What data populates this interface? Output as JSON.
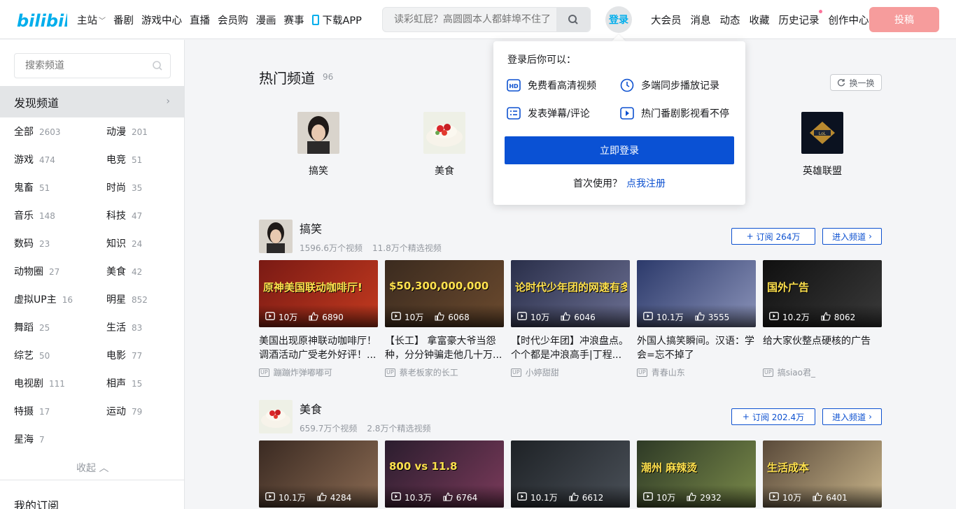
{
  "header": {
    "logo_text": "bilibili",
    "nav_left": [
      "主站",
      "番剧",
      "游戏中心",
      "直播",
      "会员购",
      "漫画",
      "赛事",
      "下载APP"
    ],
    "search_placeholder": "读彩虹屁？高圆圆本人都蚌埠不住了",
    "login_label": "登录",
    "nav_right": [
      "大会员",
      "消息",
      "动态",
      "收藏",
      "历史记录",
      "创作中心"
    ],
    "upload_label": "投稿",
    "accent": "#00aeec"
  },
  "sidebar": {
    "search_placeholder": "搜索频道",
    "discover_label": "发现频道",
    "categories": [
      {
        "name": "全部",
        "count": "2603"
      },
      {
        "name": "动漫",
        "count": "201"
      },
      {
        "name": "游戏",
        "count": "474"
      },
      {
        "name": "电竞",
        "count": "51"
      },
      {
        "name": "鬼畜",
        "count": "51"
      },
      {
        "name": "时尚",
        "count": "35"
      },
      {
        "name": "音乐",
        "count": "148"
      },
      {
        "name": "科技",
        "count": "47"
      },
      {
        "name": "数码",
        "count": "23"
      },
      {
        "name": "知识",
        "count": "24"
      },
      {
        "name": "动物圈",
        "count": "27"
      },
      {
        "name": "美食",
        "count": "42"
      },
      {
        "name": "虚拟UP主",
        "count": "16"
      },
      {
        "name": "明星",
        "count": "852"
      },
      {
        "name": "舞蹈",
        "count": "25"
      },
      {
        "name": "生活",
        "count": "83"
      },
      {
        "name": "综艺",
        "count": "50"
      },
      {
        "name": "电影",
        "count": "77"
      },
      {
        "name": "电视剧",
        "count": "111"
      },
      {
        "name": "相声",
        "count": "15"
      },
      {
        "name": "特摄",
        "count": "17"
      },
      {
        "name": "运动",
        "count": "79"
      },
      {
        "name": "星海",
        "count": "7"
      }
    ],
    "collapse_label": "收起",
    "my_sub_label": "我的订阅"
  },
  "hot": {
    "title": "热门频道",
    "count": "96",
    "refresh_label": "换一换",
    "channels": [
      "搞笑",
      "美食",
      "英雄联盟"
    ]
  },
  "popover": {
    "head": "登录后你可以：",
    "items": [
      "免费看高清视频",
      "多端同步播放记录",
      "发表弹幕/评论",
      "热门番剧影视看不停"
    ],
    "login_button": "立即登录",
    "foot_text": "首次使用？",
    "foot_link": "点我注册",
    "button_color": "#0a51d4"
  },
  "sections": [
    {
      "name": "搞笑",
      "videos_count": "1596.6万个视频",
      "featured_count": "11.8万个精选视频",
      "subscribe_label": "订阅 264万",
      "enter_label": "进入频道",
      "videos": [
        {
          "views": "10万",
          "likes": "6890",
          "title": "美国出现原神联动咖啡厅！调酒活动广受老外好评！...",
          "author": "蹦蹦炸弹嘟嘟可",
          "cover_text": "原神美国联动咖啡厅!"
        },
        {
          "views": "10万",
          "likes": "6068",
          "title": "【长工】 拿富豪大爷当怨种，分分钟骗走他几十万...",
          "author": "蔡老板家的长工",
          "cover_text": "$50,300,000,000"
        },
        {
          "views": "10万",
          "likes": "6046",
          "title": "【时代少年团】冲浪盘点。个个都是冲浪高手|丁程...",
          "author": "小婷甜甜",
          "cover_text": "论时代少年团的网速有多快"
        },
        {
          "views": "10.1万",
          "likes": "3555",
          "title": "外国人搞笑瞬间。汉语：学会=忘不掉了",
          "author": "青春山东",
          "cover_text": ""
        },
        {
          "views": "10.2万",
          "likes": "8062",
          "title": "给大家伙整点硬核的广告",
          "author": "搞siao君_",
          "cover_text": "国外广告"
        }
      ]
    },
    {
      "name": "美食",
      "videos_count": "659.7万个视频",
      "featured_count": "2.8万个精选视频",
      "subscribe_label": "订阅 202.4万",
      "enter_label": "进入频道",
      "videos": [
        {
          "views": "10.1万",
          "likes": "4284",
          "cover_text": ""
        },
        {
          "views": "10.3万",
          "likes": "6764",
          "cover_text": "800 vs 11.8"
        },
        {
          "views": "10.1万",
          "likes": "6612",
          "cover_text": ""
        },
        {
          "views": "10万",
          "likes": "2932",
          "cover_text": "潮州 麻辣烫"
        },
        {
          "views": "10万",
          "likes": "6401",
          "cover_text": "生活成本"
        }
      ]
    }
  ]
}
